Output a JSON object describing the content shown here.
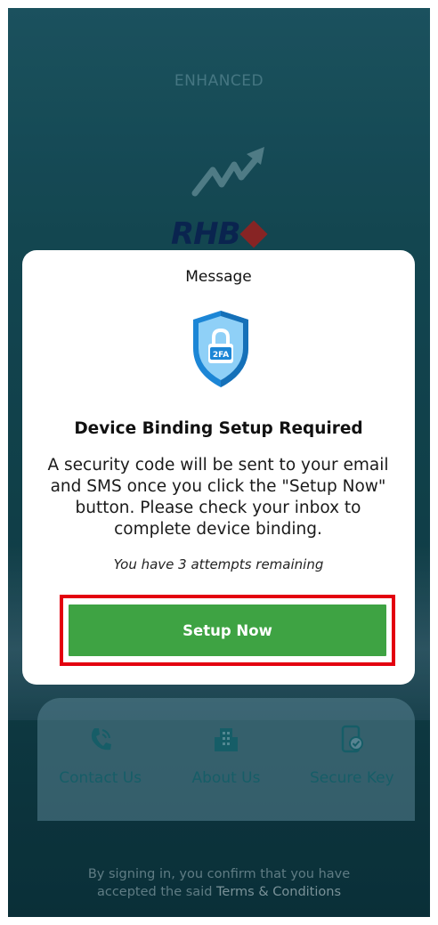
{
  "background": {
    "tagline": "ENHANCED",
    "brand": "RHB",
    "quick_actions": [
      {
        "label": "Contact Us",
        "icon": "phone-icon"
      },
      {
        "label": "About Us",
        "icon": "building-icon"
      },
      {
        "label": "Secure Key",
        "icon": "phone-check-icon"
      }
    ],
    "terms_prefix": "By signing in, you confirm that you have",
    "terms_middle": "accepted the said ",
    "terms_link": "Terms & Conditions"
  },
  "dialog": {
    "title": "Message",
    "badge": "2FA",
    "heading": "Device Binding Setup Required",
    "body": "A security code will be sent to your email and SMS once you click the \"Setup Now\" button. Please check your inbox to complete device binding.",
    "attempts": "You have 3 attempts remaining",
    "button_label": "Setup Now"
  },
  "colors": {
    "primary_button": "#3ea343",
    "highlight": "#e3000f",
    "background": "#16505c"
  }
}
